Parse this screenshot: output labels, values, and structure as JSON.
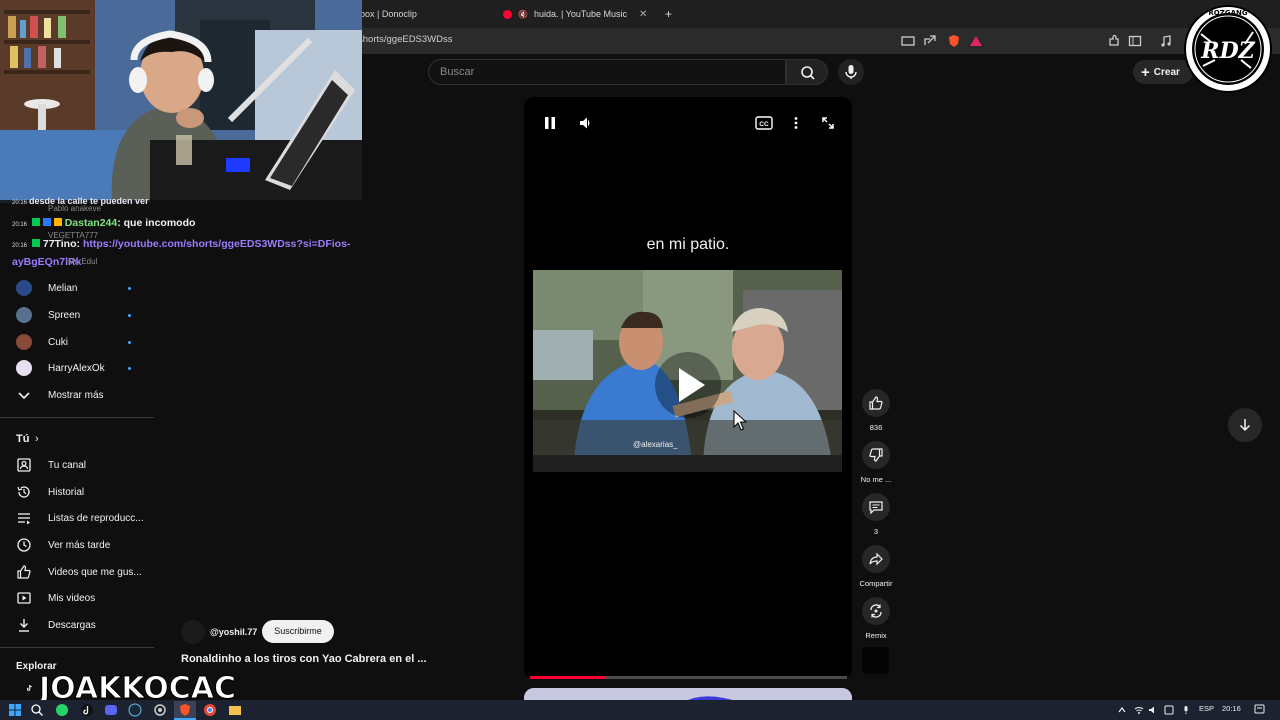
{
  "browser": {
    "tabs": [
      {
        "label": "box | Donoclip"
      },
      {
        "label": "huida. | YouTube Music"
      }
    ],
    "new_tab": "+",
    "url": "shorts/ggeEDS3WDss"
  },
  "header": {
    "search_placeholder": "Buscar",
    "create_label": "Crear"
  },
  "sidebar": {
    "subscriptions": [
      {
        "label": "Melian",
        "icon": "avatar"
      },
      {
        "label": "Spreen",
        "icon": "avatar"
      },
      {
        "label": "Cuki",
        "icon": "avatar"
      },
      {
        "label": "HarryAlexOk",
        "icon": "avatar"
      }
    ],
    "show_more": "Mostrar más",
    "you_heading": "Tú",
    "you_items": [
      {
        "label": "Tu canal",
        "icon": "channel-icon"
      },
      {
        "label": "Historial",
        "icon": "history-icon"
      },
      {
        "label": "Listas de reproducc...",
        "icon": "playlists-icon"
      },
      {
        "label": "Ver más tarde",
        "icon": "watch-later-icon"
      },
      {
        "label": "Videos que me gus...",
        "icon": "like-icon"
      },
      {
        "label": "Mis videos",
        "icon": "my-videos-icon"
      },
      {
        "label": "Descargas",
        "icon": "download-icon"
      }
    ],
    "explore_heading": "Explorar"
  },
  "chat": {
    "partial_top": "desde la calle te pueden ver",
    "behind_1": "Pablo anakeve",
    "behind_2": "VEGETTA777",
    "behind_3": "Mr. Edul",
    "messages": [
      {
        "time": "20:16",
        "user": "Dastan244",
        "text": ": que incomodo",
        "user_color": "#7fe37f"
      },
      {
        "time": "20:16",
        "user": "77Tino",
        "text": ": ",
        "link": "https://youtube.com/shorts/ggeEDS3WDss?si=DFios-",
        "link_cont": "ayBgEQn7lRk",
        "user_color": "#ffffff"
      }
    ]
  },
  "player": {
    "caption": "en mi patio.",
    "watermark": "@alexarias_",
    "progress": 0.24
  },
  "actions": {
    "likes": "836",
    "dislike_label": "No me ...",
    "comments": "3",
    "share_label": "Compartir",
    "remix_label": "Remix"
  },
  "short": {
    "channel": "@yoshil.77",
    "subscribe_label": "Suscribirme",
    "title": "Ronaldinho a los tiros con Yao Cabrera en el ..."
  },
  "overlay": {
    "tiktok_handle": "JOAKKOCAC",
    "logo_text": "RDZ",
    "logo_ring": "ROZGANG"
  },
  "taskbar": {
    "lang": "ESP",
    "time": "20:16"
  },
  "colors": {
    "accent_red": "#ff0033",
    "link_blue": "#3ea6ff",
    "chat_link": "#9d7bff"
  }
}
